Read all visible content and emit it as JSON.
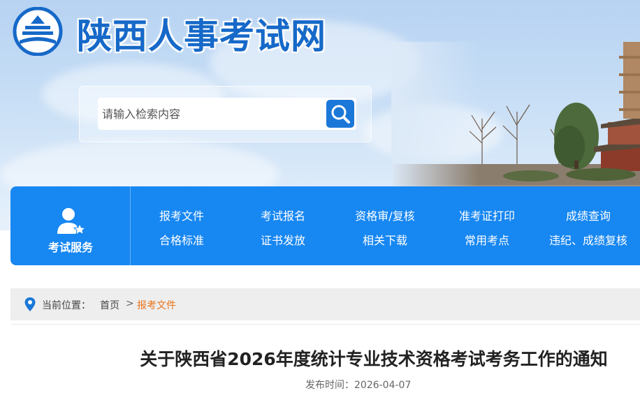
{
  "site": {
    "title": "陕西人事考试网",
    "logo_icon": "pagoda-emblem-icon"
  },
  "search": {
    "placeholder": "请输入检索内容",
    "button_icon": "search-icon"
  },
  "nav": {
    "service_label": "考试服务",
    "service_icon": "user-star-icon",
    "links_row1": [
      "报考文件",
      "考试报名",
      "资格审/复核",
      "准考证打印",
      "成绩查询"
    ],
    "links_row2": [
      "合格标准",
      "证书发放",
      "相关下载",
      "常用考点",
      "违纪、成绩复核"
    ]
  },
  "breadcrumb": {
    "prefix": "当前位置：",
    "home": "首页",
    "separator": ">",
    "current": "报考文件"
  },
  "article": {
    "title": "关于陕西省2026年度统计专业技术资格考试考务工作的通知",
    "date_label": "发布时间：",
    "date": "2026-04-07"
  },
  "colors": {
    "brand_blue": "#1787f2",
    "title_blue": "#1669c8",
    "crumb_active": "#e8731a"
  }
}
